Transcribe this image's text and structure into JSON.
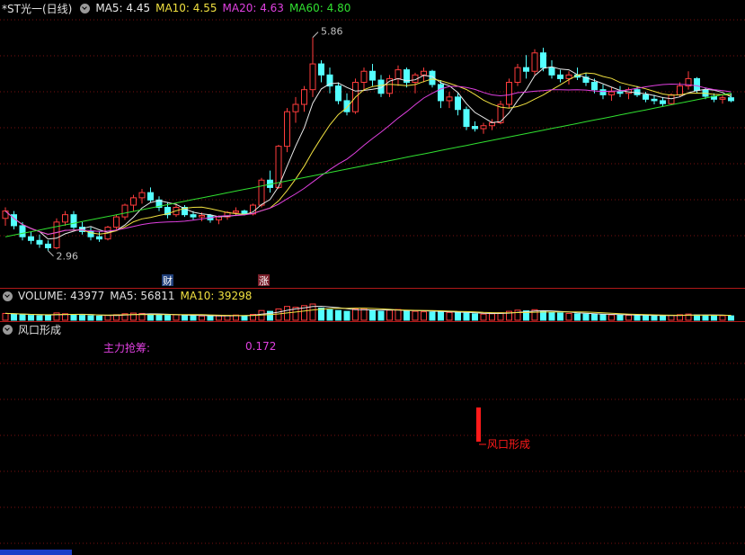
{
  "price_header": {
    "title": "*ST光一(日线)",
    "ma5": "MA5: 4.45",
    "ma10": "MA10: 4.55",
    "ma20": "MA20: 4.63",
    "ma60": "MA60: 4.80"
  },
  "price_annotations": {
    "high": "5.86",
    "low": "2.96",
    "badge_cai": "财",
    "badge_zhang": "涨"
  },
  "volume_header": {
    "volume": "VOLUME: 43977",
    "ma5": "MA5: 56811",
    "ma10": "MA10: 39298"
  },
  "indicator_header": {
    "name": "风口形成"
  },
  "indicator": {
    "label": "主力抢筹:",
    "value": "0.172",
    "signal_label": "风口形成"
  },
  "colors": {
    "up": "#ff3c3c",
    "down": "#54ffff",
    "ma5": "#e8e8e8",
    "ma10": "#f0e040",
    "ma20": "#e040e0",
    "ma60": "#30e030",
    "grid": "#7a1010",
    "signal": "#ff1a1a"
  },
  "chart_data": {
    "type": "candlestick",
    "ylim": [
      2.7,
      6.1
    ],
    "high": 5.86,
    "low": 2.96,
    "candles": [
      [
        3.4,
        3.55,
        3.3,
        3.5
      ],
      [
        3.45,
        3.5,
        3.25,
        3.3
      ],
      [
        3.3,
        3.35,
        3.1,
        3.15
      ],
      [
        3.15,
        3.22,
        3.05,
        3.1
      ],
      [
        3.1,
        3.18,
        3.0,
        3.05
      ],
      [
        3.05,
        3.1,
        2.96,
        3.0
      ],
      [
        3.0,
        3.4,
        2.98,
        3.35
      ],
      [
        3.35,
        3.5,
        3.3,
        3.45
      ],
      [
        3.45,
        3.5,
        3.25,
        3.28
      ],
      [
        3.28,
        3.35,
        3.18,
        3.22
      ],
      [
        3.22,
        3.28,
        3.1,
        3.15
      ],
      [
        3.15,
        3.22,
        3.08,
        3.12
      ],
      [
        3.12,
        3.3,
        3.1,
        3.28
      ],
      [
        3.28,
        3.45,
        3.25,
        3.42
      ],
      [
        3.42,
        3.6,
        3.38,
        3.58
      ],
      [
        3.58,
        3.72,
        3.5,
        3.68
      ],
      [
        3.68,
        3.8,
        3.6,
        3.75
      ],
      [
        3.75,
        3.82,
        3.62,
        3.65
      ],
      [
        3.65,
        3.7,
        3.5,
        3.55
      ],
      [
        3.55,
        3.62,
        3.4,
        3.45
      ],
      [
        3.45,
        3.6,
        3.42,
        3.55
      ],
      [
        3.55,
        3.58,
        3.42,
        3.45
      ],
      [
        3.45,
        3.5,
        3.38,
        3.42
      ],
      [
        3.42,
        3.48,
        3.36,
        3.44
      ],
      [
        3.44,
        3.46,
        3.34,
        3.38
      ],
      [
        3.38,
        3.44,
        3.32,
        3.42
      ],
      [
        3.42,
        3.5,
        3.38,
        3.48
      ],
      [
        3.48,
        3.55,
        3.44,
        3.5
      ],
      [
        3.5,
        3.52,
        3.44,
        3.46
      ],
      [
        3.46,
        3.6,
        3.44,
        3.58
      ],
      [
        3.58,
        3.95,
        3.55,
        3.92
      ],
      [
        3.92,
        4.05,
        3.75,
        3.82
      ],
      [
        3.82,
        4.4,
        3.8,
        4.38
      ],
      [
        4.38,
        4.9,
        4.3,
        4.85
      ],
      [
        4.85,
        5.05,
        4.7,
        4.95
      ],
      [
        4.95,
        5.2,
        4.85,
        5.15
      ],
      [
        5.15,
        5.86,
        5.05,
        5.5
      ],
      [
        5.5,
        5.55,
        5.25,
        5.35
      ],
      [
        5.35,
        5.45,
        5.1,
        5.2
      ],
      [
        5.2,
        5.25,
        4.95,
        5.0
      ],
      [
        5.0,
        5.1,
        4.8,
        4.85
      ],
      [
        4.85,
        5.3,
        4.82,
        5.25
      ],
      [
        5.25,
        5.45,
        5.15,
        5.4
      ],
      [
        5.4,
        5.5,
        5.2,
        5.28
      ],
      [
        5.28,
        5.35,
        5.05,
        5.1
      ],
      [
        5.1,
        5.35,
        5.05,
        5.3
      ],
      [
        5.3,
        5.48,
        5.2,
        5.42
      ],
      [
        5.42,
        5.45,
        5.18,
        5.25
      ],
      [
        5.25,
        5.38,
        5.1,
        5.35
      ],
      [
        5.35,
        5.45,
        5.25,
        5.4
      ],
      [
        5.4,
        5.42,
        5.18,
        5.22
      ],
      [
        5.22,
        5.28,
        4.9,
        5.0
      ],
      [
        5.0,
        5.12,
        4.9,
        5.05
      ],
      [
        5.05,
        5.1,
        4.8,
        4.88
      ],
      [
        4.88,
        4.92,
        4.6,
        4.65
      ],
      [
        4.65,
        4.72,
        4.58,
        4.62
      ],
      [
        4.62,
        4.7,
        4.55,
        4.66
      ],
      [
        4.66,
        4.75,
        4.6,
        4.7
      ],
      [
        4.7,
        5.0,
        4.68,
        4.95
      ],
      [
        4.95,
        5.3,
        4.9,
        5.25
      ],
      [
        5.25,
        5.5,
        5.2,
        5.45
      ],
      [
        5.45,
        5.62,
        5.3,
        5.4
      ],
      [
        5.4,
        5.7,
        5.35,
        5.65
      ],
      [
        5.65,
        5.72,
        5.4,
        5.45
      ],
      [
        5.45,
        5.55,
        5.3,
        5.35
      ],
      [
        5.35,
        5.42,
        5.25,
        5.3
      ],
      [
        5.3,
        5.4,
        5.22,
        5.35
      ],
      [
        5.35,
        5.45,
        5.28,
        5.32
      ],
      [
        5.32,
        5.38,
        5.2,
        5.25
      ],
      [
        5.25,
        5.3,
        5.1,
        5.15
      ],
      [
        5.15,
        5.22,
        5.02,
        5.08
      ],
      [
        5.08,
        5.18,
        5.0,
        5.12
      ],
      [
        5.12,
        5.2,
        5.05,
        5.1
      ],
      [
        5.1,
        5.18,
        5.02,
        5.15
      ],
      [
        5.15,
        5.2,
        5.05,
        5.08
      ],
      [
        5.08,
        5.12,
        4.98,
        5.02
      ],
      [
        5.02,
        5.08,
        4.95,
        5.0
      ],
      [
        5.0,
        5.05,
        4.92,
        4.96
      ],
      [
        4.96,
        5.1,
        4.94,
        5.08
      ],
      [
        5.08,
        5.25,
        5.05,
        5.2
      ],
      [
        5.2,
        5.4,
        5.15,
        5.3
      ],
      [
        5.3,
        5.32,
        5.1,
        5.14
      ],
      [
        5.14,
        5.18,
        5.02,
        5.06
      ],
      [
        5.06,
        5.1,
        4.98,
        5.02
      ],
      [
        5.02,
        5.08,
        4.96,
        5.04
      ],
      [
        5.04,
        5.1,
        4.98,
        5.0
      ]
    ],
    "volumes": [
      0.42,
      0.38,
      0.35,
      0.3,
      0.28,
      0.32,
      0.45,
      0.4,
      0.36,
      0.3,
      0.28,
      0.26,
      0.3,
      0.34,
      0.4,
      0.44,
      0.42,
      0.36,
      0.32,
      0.3,
      0.34,
      0.3,
      0.28,
      0.26,
      0.25,
      0.27,
      0.3,
      0.32,
      0.28,
      0.36,
      0.6,
      0.55,
      0.7,
      0.85,
      0.8,
      0.9,
      1.0,
      0.75,
      0.65,
      0.6,
      0.55,
      0.7,
      0.72,
      0.6,
      0.55,
      0.62,
      0.66,
      0.58,
      0.55,
      0.52,
      0.5,
      0.55,
      0.48,
      0.46,
      0.44,
      0.4,
      0.38,
      0.4,
      0.46,
      0.55,
      0.62,
      0.58,
      0.65,
      0.55,
      0.48,
      0.45,
      0.42,
      0.4,
      0.38,
      0.36,
      0.34,
      0.33,
      0.32,
      0.31,
      0.3,
      0.29,
      0.28,
      0.27,
      0.3,
      0.34,
      0.38,
      0.33,
      0.3,
      0.29,
      0.28,
      0.27
    ],
    "signal_index": 64
  }
}
